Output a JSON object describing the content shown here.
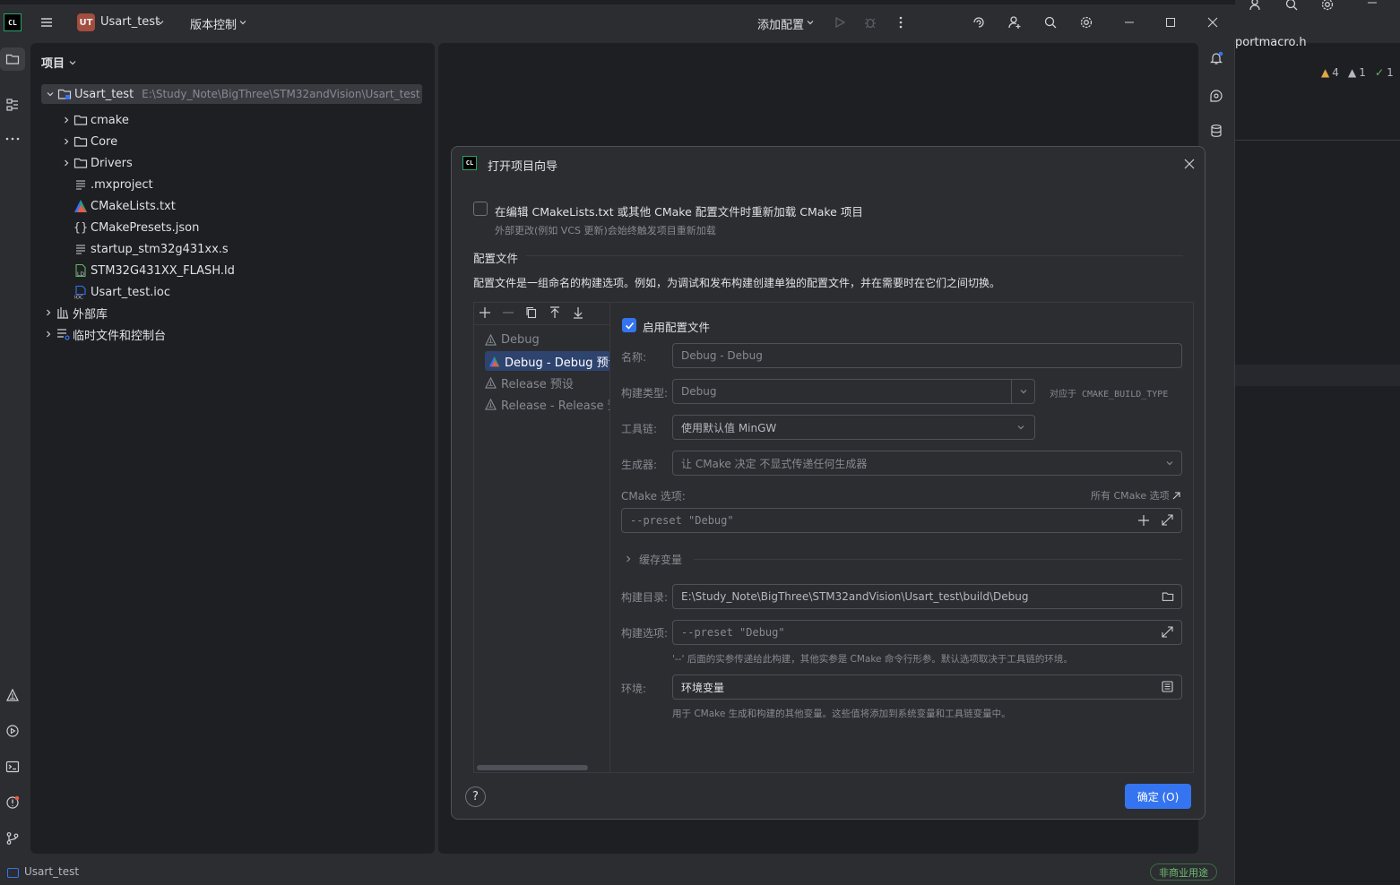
{
  "background_window": {
    "tab_title": "portmacro.h",
    "warnings": [
      {
        "icon": "warning-icon",
        "count": "4"
      },
      {
        "icon": "weak-warning-icon",
        "count": "1"
      },
      {
        "icon": "check-icon",
        "count": "1"
      }
    ]
  },
  "titlebar": {
    "app_logo": "CL",
    "project_badge": "UT",
    "project_name": "Usart_test",
    "vcs_label": "版本控制",
    "run_config_label": "添加配置"
  },
  "project_panel": {
    "title": "项目",
    "tree": [
      {
        "label": "Usart_test",
        "path": "E:\\Study_Note\\BigThree\\STM32andVision\\Usart_test",
        "icon": "project-folder-icon"
      },
      {
        "label": "cmake",
        "icon": "folder-icon"
      },
      {
        "label": "Core",
        "icon": "folder-icon"
      },
      {
        "label": "Drivers",
        "icon": "folder-icon"
      },
      {
        "label": ".mxproject",
        "icon": "text-file-icon"
      },
      {
        "label": "CMakeLists.txt",
        "icon": "cmake-icon"
      },
      {
        "label": "CMakePresets.json",
        "icon": "json-icon"
      },
      {
        "label": "startup_stm32g431xx.s",
        "icon": "text-file-icon"
      },
      {
        "label": "STM32G431XX_FLASH.ld",
        "icon": "ld-file-icon"
      },
      {
        "label": "Usart_test.ioc",
        "icon": "ioc-file-icon"
      },
      {
        "label": "外部库",
        "icon": "library-icon"
      },
      {
        "label": "临时文件和控制台",
        "icon": "scratches-icon"
      }
    ]
  },
  "dialog": {
    "logo": "CL",
    "title": "打开项目向导",
    "reload_checkbox_label": "在编辑 CMakeLists.txt 或其他 CMake 配置文件时重新加载 CMake 项目",
    "reload_hint": "外部更改(例如 VCS 更新)会始终触发项目重新加载",
    "section_title": "配置文件",
    "section_desc": "配置文件是一组命名的构建选项。例如，为调试和发布构建创建单独的配置文件，并在需要时在它们之间切换。",
    "profiles": [
      "Debug",
      "Debug - Debug 预设",
      "Release 预设",
      "Release - Release 预设"
    ],
    "selected_profile_index": 1,
    "enable_profile_label": "启用配置文件",
    "enable_profile_checked": true,
    "name_label": "名称:",
    "name_value": "Debug - Debug",
    "build_type_label": "构建类型:",
    "build_type_value": "Debug",
    "build_type_hint": "对应于 CMAKE_BUILD_TYPE",
    "toolchain_label": "工具链:",
    "toolchain_value": "使用默认值  MinGW",
    "generator_label": "生成器:",
    "generator_value": "让 CMake 决定  不显式传递任何生成器",
    "cmake_options_label": "CMake 选项:",
    "all_cmake_options_link": "所有 CMake 选项",
    "cmake_options_value": "--preset \"Debug\"",
    "cache_vars_label": "缓存变量",
    "build_dir_label": "构建目录:",
    "build_dir_value": "E:\\Study_Note\\BigThree\\STM32andVision\\Usart_test\\build\\Debug",
    "build_options_label": "构建选项:",
    "build_options_value": "--preset \"Debug\"",
    "build_options_hint": "'--' 后面的实参传递给此构建，其他实参是 CMake 命令行形参。默认选项取决于工具链的环境。",
    "env_label": "环境:",
    "env_value": "环境变量",
    "env_hint": "用于 CMake 生成和构建的其他变量。这些值将添加到系统变量和工具链变量中。",
    "help_label": "?",
    "ok_button": "确定 (O)"
  },
  "statusbar": {
    "project": "Usart_test",
    "license_badge": "非商业用途"
  },
  "colors": {
    "accent": "#3574f0",
    "panel_bg": "#1e1f22",
    "window_bg": "#2b2d30",
    "selection": "#2e436e"
  }
}
